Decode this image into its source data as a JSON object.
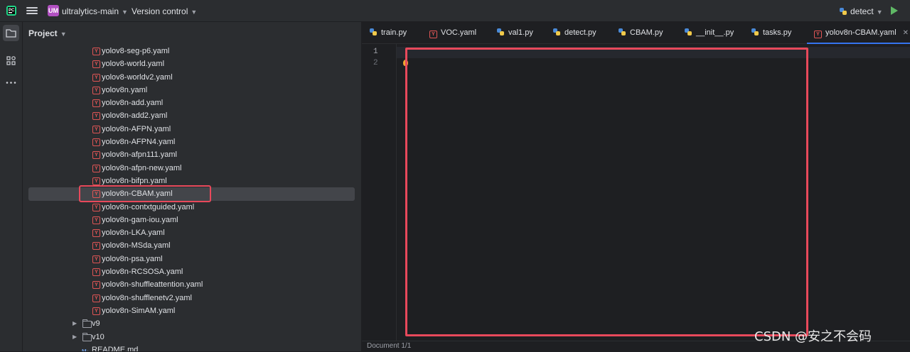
{
  "titlebar": {
    "project_badge": "UM",
    "project_name": "ultralytics-main",
    "vcs_label": "Version control",
    "run_config": "detect"
  },
  "project_panel": {
    "header": "Project",
    "files": [
      "yolov8-seg-p6.yaml",
      "yolov8-world.yaml",
      "yolov8-worldv2.yaml",
      "yolov8n.yaml",
      "yolov8n-add.yaml",
      "yolov8n-add2.yaml",
      "yolov8n-AFPN.yaml",
      "yolov8n-AFPN4.yaml",
      "yolov8n-afpn111.yaml",
      "yolov8n-afpn-new.yaml",
      "yolov8n-bifpn.yaml",
      "yolov8n-CBAM.yaml",
      "yolov8n-contxtguided.yaml",
      "yolov8n-gam-iou.yaml",
      "yolov8n-LKA.yaml",
      "yolov8n-MSda.yaml",
      "yolov8n-psa.yaml",
      "yolov8n-RCSOSA.yaml",
      "yolov8n-shuffleattention.yaml",
      "yolov8n-shufflenetv2.yaml",
      "yolov8n-SimAM.yaml"
    ],
    "selected_file": "yolov8n-CBAM.yaml",
    "folders": [
      "v9",
      "v10"
    ],
    "readme": "README.md"
  },
  "editor": {
    "tabs": [
      {
        "label": "train.py",
        "icon": "python-icon"
      },
      {
        "label": "VOC.yaml",
        "icon": "yaml-icon"
      },
      {
        "label": "val1.py",
        "icon": "python-icon"
      },
      {
        "label": "detect.py",
        "icon": "python-icon"
      },
      {
        "label": "CBAM.py",
        "icon": "python-icon"
      },
      {
        "label": "__init__.py",
        "icon": "python-icon"
      },
      {
        "label": "tasks.py",
        "icon": "python-icon"
      },
      {
        "label": "yolov8n-CBAM.yaml",
        "icon": "yaml-icon"
      }
    ],
    "active_tab": "yolov8n-CBAM.yaml",
    "line_numbers": [
      "1",
      "2"
    ],
    "status": "Document 1/1"
  },
  "watermark": "CSDN @安之不会码",
  "colors": {
    "highlight": "#e8495b",
    "accent": "#3574f0",
    "background": "#1e1f22",
    "panel": "#2b2d30"
  }
}
